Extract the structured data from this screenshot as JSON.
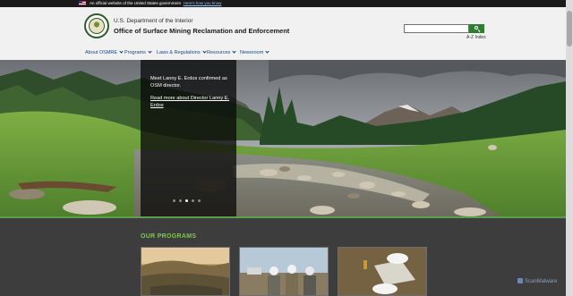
{
  "gov_banner": {
    "text": "An official website of the United States government",
    "link": "Here's how you know"
  },
  "header": {
    "department": "U.S. Department of the Interior",
    "agency": "Office of Surface Mining Reclamation and Enforcement",
    "search_value": "",
    "az_index": "A-Z Index"
  },
  "nav": {
    "items": [
      {
        "label": "About OSMRE"
      },
      {
        "label": "Programs"
      },
      {
        "label": "Laws & Regulations"
      },
      {
        "label": "Resources"
      },
      {
        "label": "Newsroom"
      }
    ]
  },
  "hero": {
    "text": "Meet Lanny E. Erdos confirmed as OSM director.",
    "link": "Read more about Director Lanny E. Erdos",
    "slide_count": 5,
    "active_slide": 3
  },
  "programs": {
    "title": "OUR PROGRAMS"
  },
  "watermark": "ScanMalware",
  "colors": {
    "banner": "#1b1b1b",
    "nav_link": "#1a4480",
    "search_button": "#2e7d32",
    "accent_green": "#7ec850",
    "programs_bg": "#3d3d3d"
  }
}
